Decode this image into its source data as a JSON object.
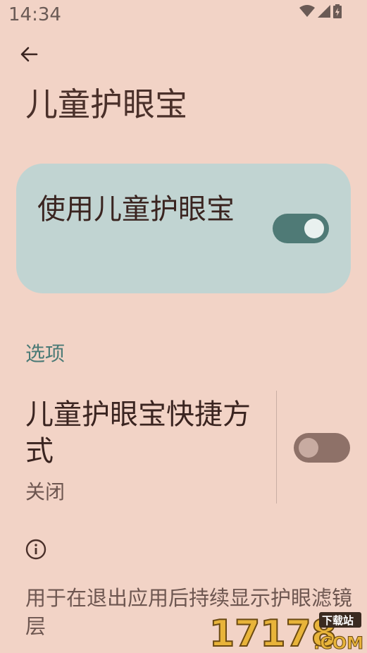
{
  "status_bar": {
    "time": "14:34",
    "icons": [
      "wifi-icon",
      "cell-signal-icon",
      "battery-charging-icon"
    ]
  },
  "nav": {
    "back_icon": "arrow-back-icon"
  },
  "page": {
    "title": "儿童护眼宝"
  },
  "main_toggle": {
    "label": "使用儿童护眼宝",
    "checked": true
  },
  "options": {
    "section_title": "选项",
    "shortcut": {
      "title": "儿童护眼宝快捷方式",
      "summary": "关闭",
      "checked": false
    }
  },
  "footer": {
    "icon": "info-icon",
    "text": "用于在退出应用后持续显示护眼滤镜层"
  },
  "watermark": {
    "brand": "17178",
    "domain": ".COM",
    "tag": "下载站"
  },
  "colors": {
    "background": "#f2d3c6",
    "card": "#c1d4d2",
    "toggle_on": "#4f7a76",
    "toggle_off": "#8e7168",
    "accent_text": "#4a7a76"
  }
}
